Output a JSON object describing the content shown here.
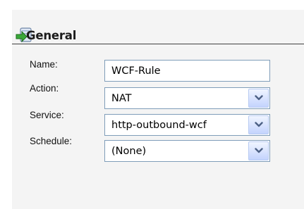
{
  "section": {
    "title": "General",
    "icon": "green-arrow-page-icon"
  },
  "form": {
    "name_label": "Name:",
    "name_value": "WCF-Rule",
    "action_label": "Action:",
    "action_value": "NAT",
    "service_label": "Service:",
    "service_value": "http-outbound-wcf",
    "schedule_label": "Schedule:",
    "schedule_value": "(None)"
  },
  "colors": {
    "field_border": "#7f9db9",
    "dropdown_arrow": "#4d6185",
    "panel_bg": "#f4f4f4"
  }
}
